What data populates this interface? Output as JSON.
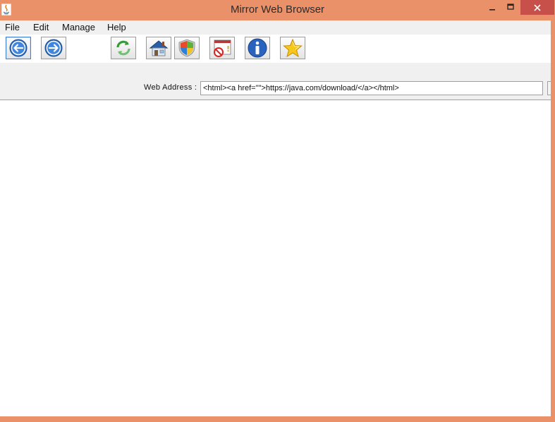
{
  "window": {
    "title": "Mirror Web Browser",
    "frame_color": "#ea9169",
    "close_color": "#c7504a"
  },
  "menu": [
    "File",
    "Edit",
    "Manage",
    "Help"
  ],
  "toolbar": {
    "buttons": [
      {
        "name": "back-button",
        "icon": "back-arrow-icon"
      },
      {
        "name": "forward-button",
        "icon": "forward-arrow-icon"
      },
      {
        "name": "refresh-button",
        "icon": "refresh-icon"
      },
      {
        "name": "home-button",
        "icon": "home-icon"
      },
      {
        "name": "security-button",
        "icon": "shield-icon"
      },
      {
        "name": "stop-button",
        "icon": "stop-warning-icon"
      },
      {
        "name": "info-button",
        "icon": "info-icon"
      },
      {
        "name": "favorites-button",
        "icon": "star-icon"
      }
    ]
  },
  "address_bar": {
    "label": "Web  Address :",
    "value": "<html><a href=\"\">https://java.com/download/</a></html>"
  }
}
